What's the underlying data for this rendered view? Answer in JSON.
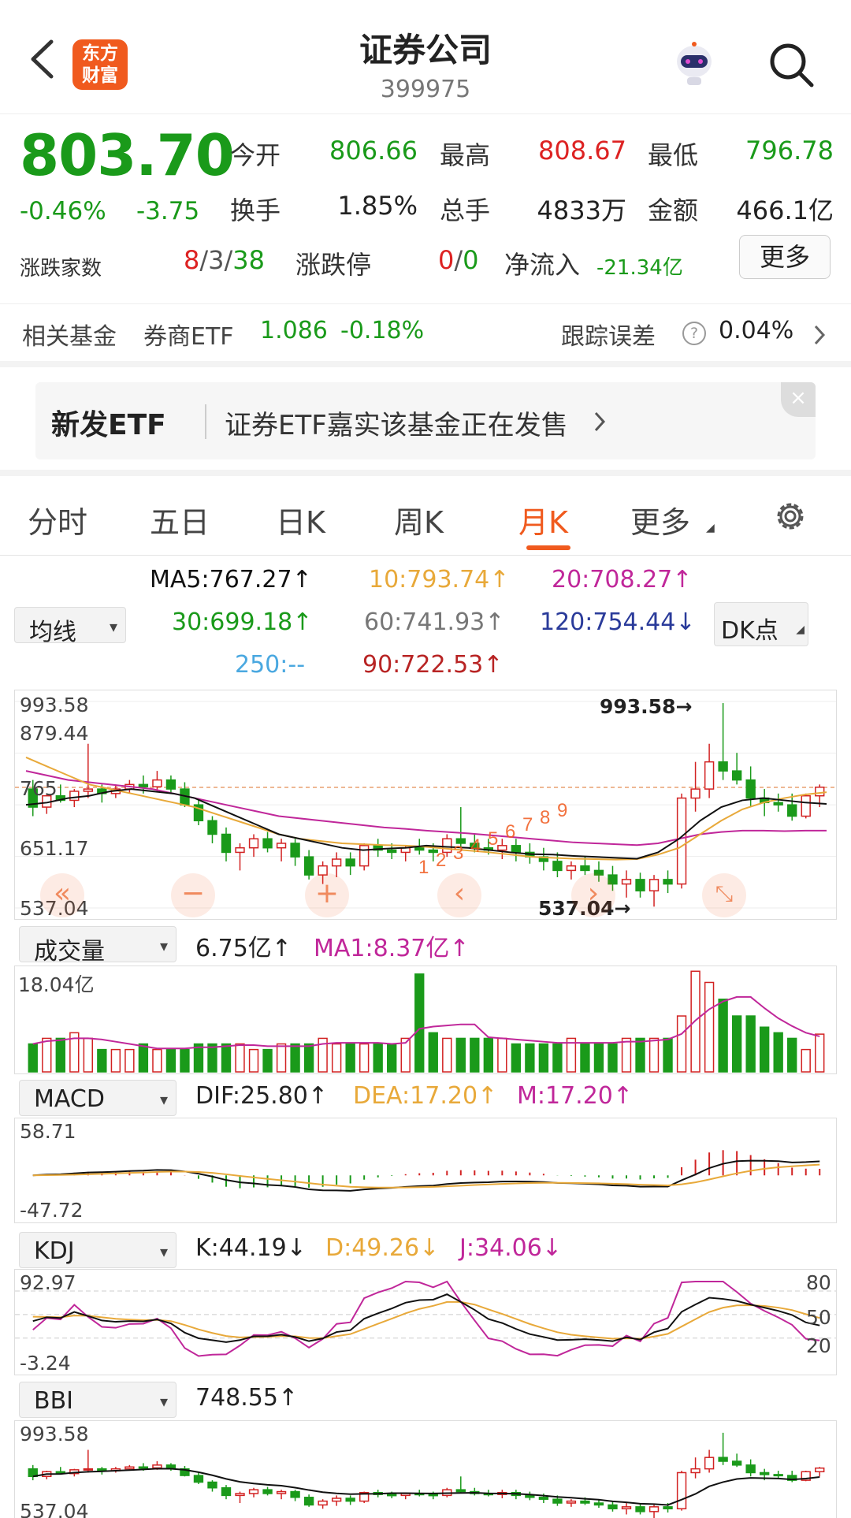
{
  "header": {
    "title": "证券公司",
    "code": "399975",
    "logo_line1": "东方",
    "logo_line2": "财富"
  },
  "quote": {
    "price": "803.70",
    "change_pct": "-0.46%",
    "change": "-3.75",
    "open_label": "今开",
    "open": "806.66",
    "high_label": "最高",
    "high": "808.67",
    "low_label": "最低",
    "low": "796.78",
    "turnover_label": "换手",
    "turnover": "1.85%",
    "volume_label": "总手",
    "volume": "4833万",
    "amount_label": "金额",
    "amount": "466.1亿",
    "breadth_label": "涨跌家数",
    "breadth_up": "8",
    "breadth_flat": "3",
    "breadth_down": "38",
    "limit_label": "涨跌停",
    "limit_up": "0",
    "limit_down": "0",
    "netflow_label": "净流入",
    "netflow": "-21.34亿",
    "more_label": "更多",
    "slash": "/"
  },
  "fund": {
    "label": "相关基金",
    "name": "券商ETF",
    "price": "1.086",
    "pct": "-0.18%",
    "tracking_label": "跟踪误差",
    "tracking_value": "0.04%",
    "help": "?"
  },
  "banner": {
    "tag": "新发ETF",
    "text": "证券ETF嘉实该基金正在发售",
    "close": "×"
  },
  "tabs": [
    {
      "label": "分时"
    },
    {
      "label": "五日"
    },
    {
      "label": "日K"
    },
    {
      "label": "周K"
    },
    {
      "label": "月K"
    },
    {
      "label": "更多"
    }
  ],
  "ma_legend": {
    "ma5": "MA5:767.27↑",
    "ma10": "10:793.74↑",
    "ma20": "20:708.27↑",
    "ma30": "30:699.18↑",
    "ma60": "60:741.93↑",
    "ma120": "120:754.44↓",
    "ma250": "250:--",
    "ma90": "90:722.53↑",
    "selector": "均线",
    "dk": "DK点"
  },
  "colors": {
    "up": "#d22222",
    "down": "#1a9a1a",
    "ma5": "#111111",
    "ma10": "#e8a93a",
    "ma20": "#c0279a",
    "ma30": "#1a9a1a",
    "ma60": "#777777",
    "ma120": "#2a3b9a",
    "ma250": "#4aa8e0",
    "ma90": "#b82424"
  },
  "kline": {
    "y_labels": [
      "993.58",
      "879.44",
      "765",
      "651.17",
      "537.04"
    ],
    "max_label": "993.58→",
    "min_label": "537.04→",
    "td_numbers": [
      "1",
      "2",
      "3",
      "4",
      "5",
      "6",
      "7",
      "8",
      "9"
    ]
  },
  "volume": {
    "selector": "成交量",
    "value": "6.75亿↑",
    "ma1": "MA1:8.37亿↑",
    "y_label": "18.04亿"
  },
  "macd": {
    "selector": "MACD",
    "dif": "DIF:25.80↑",
    "dea": "DEA:17.20↑",
    "m": "M:17.20↑",
    "y_top": "58.71",
    "y_bottom": "-47.72"
  },
  "kdj": {
    "selector": "KDJ",
    "k": "K:44.19↓",
    "d": "D:49.26↓",
    "j": "J:34.06↓",
    "y_top": "92.97",
    "y_bottom": "-3.24",
    "levels": [
      "80",
      "50",
      "20"
    ]
  },
  "bbi": {
    "selector": "BBI",
    "value": "748.55↑",
    "y_top": "993.58",
    "y_bottom": "537.04"
  },
  "chart_data": {
    "type": "candlestick",
    "ylim": [
      537.04,
      993.58
    ],
    "candles": [
      [
        800,
        820,
        740,
        760
      ],
      [
        760,
        790,
        745,
        785
      ],
      [
        785,
        810,
        770,
        775
      ],
      [
        775,
        800,
        760,
        795
      ],
      [
        795,
        900,
        780,
        800
      ],
      [
        800,
        810,
        770,
        790
      ],
      [
        790,
        810,
        780,
        800
      ],
      [
        800,
        820,
        790,
        810
      ],
      [
        810,
        830,
        790,
        805
      ],
      [
        805,
        840,
        795,
        820
      ],
      [
        820,
        830,
        790,
        800
      ],
      [
        800,
        815,
        760,
        765
      ],
      [
        765,
        780,
        720,
        730
      ],
      [
        730,
        740,
        680,
        700
      ],
      [
        700,
        715,
        640,
        660
      ],
      [
        660,
        680,
        620,
        670
      ],
      [
        670,
        700,
        650,
        690
      ],
      [
        690,
        705,
        660,
        670
      ],
      [
        670,
        690,
        640,
        680
      ],
      [
        680,
        690,
        630,
        650
      ],
      [
        650,
        665,
        600,
        610
      ],
      [
        610,
        640,
        590,
        630
      ],
      [
        630,
        660,
        605,
        645
      ],
      [
        645,
        660,
        610,
        630
      ],
      [
        630,
        680,
        620,
        675
      ],
      [
        675,
        690,
        650,
        665
      ],
      [
        665,
        680,
        645,
        660
      ],
      [
        660,
        675,
        640,
        670
      ],
      [
        670,
        690,
        655,
        665
      ],
      [
        665,
        680,
        640,
        660
      ],
      [
        660,
        700,
        650,
        690
      ],
      [
        690,
        760,
        670,
        680
      ],
      [
        680,
        700,
        660,
        670
      ],
      [
        670,
        690,
        655,
        665
      ],
      [
        665,
        690,
        645,
        675
      ],
      [
        675,
        690,
        640,
        660
      ],
      [
        660,
        680,
        635,
        650
      ],
      [
        650,
        670,
        620,
        640
      ],
      [
        640,
        660,
        605,
        620
      ],
      [
        620,
        640,
        600,
        630
      ],
      [
        630,
        650,
        610,
        620
      ],
      [
        620,
        640,
        595,
        610
      ],
      [
        610,
        630,
        575,
        590
      ],
      [
        590,
        620,
        560,
        600
      ],
      [
        600,
        615,
        560,
        575
      ],
      [
        575,
        610,
        540,
        600
      ],
      [
        600,
        620,
        570,
        590
      ],
      [
        590,
        790,
        580,
        780
      ],
      [
        780,
        860,
        750,
        800
      ],
      [
        800,
        900,
        780,
        860
      ],
      [
        860,
        990,
        820,
        840
      ],
      [
        840,
        880,
        810,
        820
      ],
      [
        820,
        850,
        760,
        780
      ],
      [
        780,
        800,
        740,
        770
      ],
      [
        770,
        790,
        750,
        765
      ],
      [
        765,
        790,
        730,
        740
      ],
      [
        740,
        790,
        735,
        785
      ],
      [
        785,
        810,
        760,
        804
      ]
    ],
    "volumes": [
      5,
      6,
      6,
      7,
      6,
      4,
      4,
      4,
      5,
      4,
      4,
      4,
      5,
      5,
      5,
      5,
      4,
      4,
      5,
      5,
      5,
      6,
      5,
      5,
      5,
      5,
      5,
      6,
      17.5,
      7,
      6,
      6,
      6,
      6,
      6,
      5,
      5,
      5,
      5,
      6,
      5,
      5,
      5,
      6,
      6,
      6,
      6,
      10,
      18,
      16,
      13,
      10,
      10,
      8,
      7,
      6,
      4,
      6.75
    ],
    "ma_series": {
      "ma5": [
        765,
        770,
        780,
        785,
        795,
        800,
        795,
        790,
        780,
        760,
        740,
        720,
        700,
        690,
        680,
        670,
        665,
        668,
        670,
        675,
        672,
        670,
        665,
        660,
        656,
        655,
        652,
        650,
        648,
        646,
        660,
        690,
        730,
        760,
        775,
        780,
        775,
        770,
        767
      ],
      "ma10": [
        870,
        850,
        830,
        810,
        800,
        790,
        780,
        770,
        760,
        745,
        730,
        715,
        700,
        690,
        685,
        680,
        678,
        676,
        675,
        672,
        668,
        664,
        660,
        655,
        650,
        648,
        646,
        645,
        644,
        645,
        655,
        670,
        700,
        730,
        755,
        770,
        780,
        788,
        793
      ],
      "ma20": [
        840,
        830,
        820,
        815,
        810,
        805,
        800,
        790,
        780,
        770,
        760,
        750,
        740,
        735,
        730,
        725,
        720,
        715,
        712,
        708,
        705,
        702,
        698,
        694,
        690,
        686,
        682,
        680,
        678,
        676,
        680,
        690,
        700,
        705,
        708,
        708,
        707,
        708,
        708
      ]
    }
  }
}
